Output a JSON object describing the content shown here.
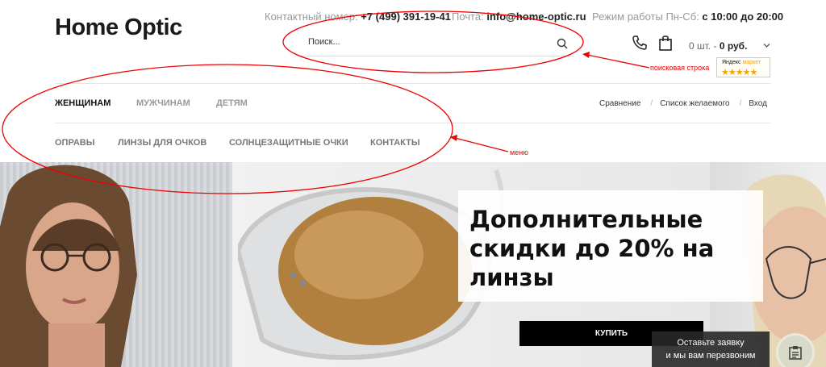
{
  "header": {
    "logo": "Home Optic",
    "contact_label": "Контактный номер:",
    "contact_phone": "+7 (499) 391-19-41",
    "email_label": "Почта:",
    "email": "info@home-optic.ru",
    "hours_label": "Режим работы Пн-Сб:",
    "hours": "с 10:00 до 20:00"
  },
  "search": {
    "placeholder": "Поиск..."
  },
  "cart": {
    "count": "0 шт.",
    "separator": " - ",
    "total": "0 руб."
  },
  "yandex_badge": {
    "text_black": "Яндекс",
    "text_orange": "маркет",
    "stars": "★★★★★"
  },
  "nav": {
    "tabs": [
      {
        "label": "Женщинам",
        "active": true
      },
      {
        "label": "Мужчинам",
        "active": false
      },
      {
        "label": "Детям",
        "active": false
      }
    ],
    "menu": [
      "Оправы",
      "Линзы для очков",
      "Солнцезащитные очки",
      "Контакты"
    ],
    "user_links": [
      "Сравнение",
      "Список желаемого",
      "Вход"
    ]
  },
  "hero": {
    "title": "Дополнительные скидки до 20% на линзы",
    "button": "Купить",
    "callback_line1": "Оставьте заявку",
    "callback_line2": "и мы вам перезвоним"
  },
  "annotations": {
    "search_label": "поисковая строка",
    "menu_label": "меню",
    "color": "#e00000"
  },
  "colors": {
    "accent": "#000000",
    "star": "#f5a300"
  }
}
